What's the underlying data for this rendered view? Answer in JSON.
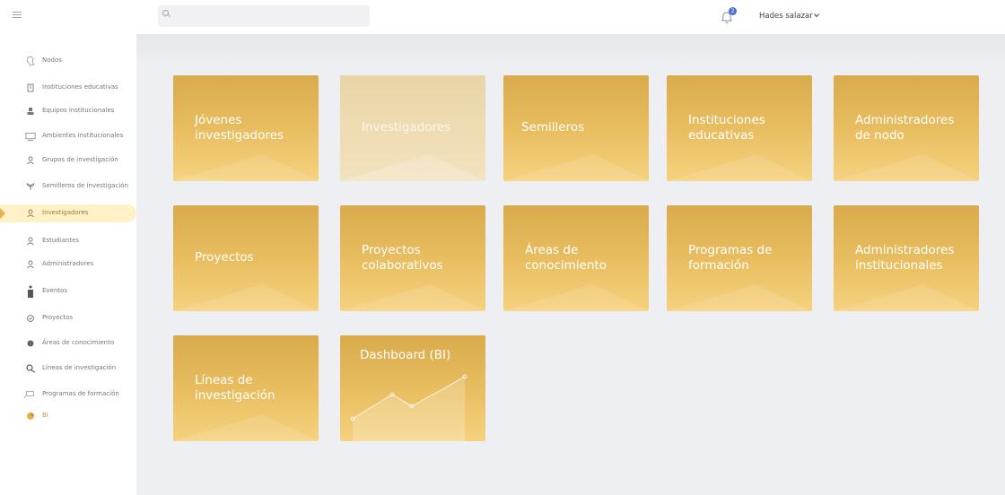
{
  "header": {
    "search_placeholder": "",
    "notification_count": "2",
    "user_name": "Hades salazar"
  },
  "sidebar": {
    "items": [
      {
        "label": "Nodos",
        "icon": "map-icon"
      },
      {
        "label": "Instituciones educativas",
        "icon": "building-icon"
      },
      {
        "label": "Equipos institucionales",
        "icon": "team-icon"
      },
      {
        "label": "Ambientes institucionales",
        "icon": "classroom-icon"
      },
      {
        "label": "Grupos de investigación",
        "icon": "user-icon"
      },
      {
        "label": "Semilleros de investigación",
        "icon": "sprout-icon"
      },
      {
        "label": "Investigadores",
        "icon": "user-icon"
      },
      {
        "label": "Estudiantes",
        "icon": "user-icon"
      },
      {
        "label": "Administradores",
        "icon": "user-icon"
      },
      {
        "label": "Eventos",
        "icon": "event-icon"
      },
      {
        "label": "Proyectos",
        "icon": "check-circle-icon"
      },
      {
        "label": "Áreas de conocimiento",
        "icon": "dot-icon"
      },
      {
        "label": "Líneas de investigación",
        "icon": "search-line-icon"
      },
      {
        "label": "Programas de formación",
        "icon": "program-icon"
      },
      {
        "label": "BI",
        "icon": "chart-icon"
      }
    ],
    "active_index": 6
  },
  "cards": [
    {
      "title": "Jóvenes\ninvestigadores"
    },
    {
      "title": "Investigadores"
    },
    {
      "title": "Semilleros"
    },
    {
      "title": "Instituciones\neducativas"
    },
    {
      "title": "Administradores\nde nodo"
    },
    {
      "title": "Proyectos"
    },
    {
      "title": "Proyectos\ncolaborativos"
    },
    {
      "title": "Áreas de\nconocimiento"
    },
    {
      "title": "Programas de\nformación"
    },
    {
      "title": "Administradores\ninstitucionales"
    },
    {
      "title": "Líneas de\ninvestigación"
    },
    {
      "title": "Dashboard (BI)"
    }
  ],
  "colors": {
    "card_gold": "#e1b24d",
    "active_bg": "#fff2c9",
    "main_bg": "#eeeff3",
    "badge_blue": "#4a6fd8"
  }
}
